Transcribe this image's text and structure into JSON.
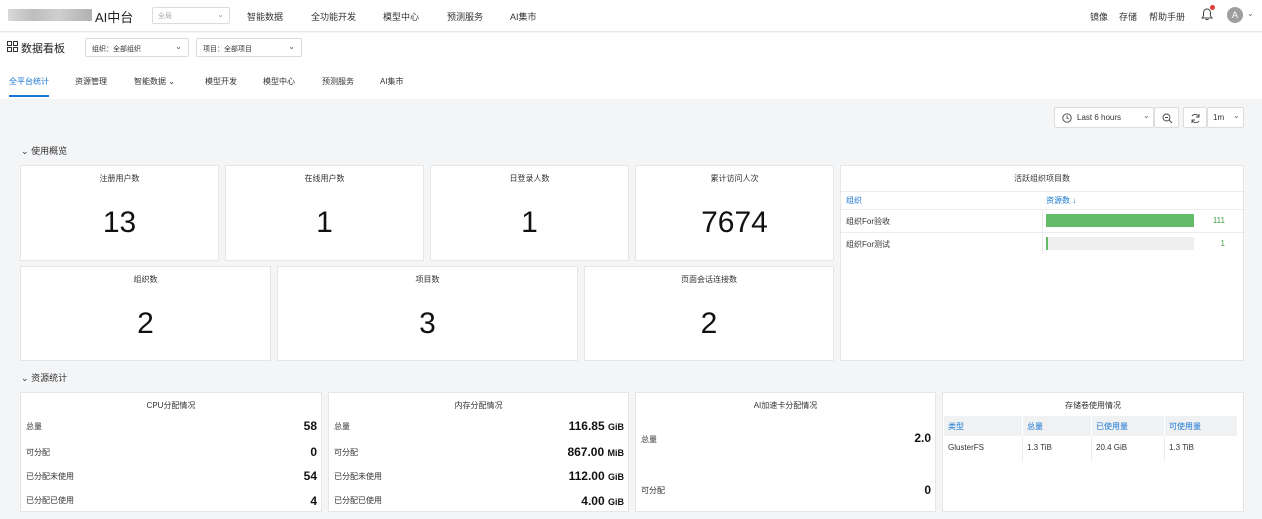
{
  "topnav": {
    "brand": "AI中台",
    "scope": "全局",
    "links": [
      "智能数据",
      "全功能开发",
      "模型中心",
      "预测服务",
      "AI集市"
    ],
    "right_links": [
      "镜像",
      "存储",
      "帮助手册"
    ],
    "avatar": "A"
  },
  "header": {
    "title": "数据看板",
    "org_filter": "组织：全部组织",
    "project_filter": "项目：全部项目"
  },
  "tabs": [
    "全平台统计",
    "资源管理",
    "智能数据",
    "模型开发",
    "模型中心",
    "预测服务",
    "AI集市"
  ],
  "time_controls": {
    "range": "Last 6 hours",
    "refresh": "1m"
  },
  "usage": {
    "section_title": "使用概览",
    "cards_row1": [
      {
        "label": "注册用户数",
        "value": "13"
      },
      {
        "label": "在线用户数",
        "value": "1"
      },
      {
        "label": "日登录人数",
        "value": "1"
      },
      {
        "label": "累计访问人次",
        "value": "7674"
      }
    ],
    "cards_row2": [
      {
        "label": "组织数",
        "value": "2"
      },
      {
        "label": "项目数",
        "value": "3"
      },
      {
        "label": "页面会话连接数",
        "value": "2"
      }
    ],
    "active_orgs": {
      "title": "活跃组织项目数",
      "col_org": "组织",
      "col_count": "资源数 ↓",
      "rows": [
        {
          "name": "组织For验收",
          "value": 111,
          "display": "111"
        },
        {
          "name": "组织For测试",
          "value": 1,
          "display": "1"
        }
      ],
      "max": 111
    }
  },
  "resources": {
    "section_title": "资源统计",
    "cpu": {
      "title": "CPU分配情况",
      "rows": [
        {
          "label": "总量",
          "value": "58",
          "unit": ""
        },
        {
          "label": "可分配",
          "value": "0",
          "unit": ""
        },
        {
          "label": "已分配未使用",
          "value": "54",
          "unit": ""
        },
        {
          "label": "已分配已使用",
          "value": "4",
          "unit": ""
        }
      ]
    },
    "memory": {
      "title": "内存分配情况",
      "rows": [
        {
          "label": "总量",
          "value": "116.85",
          "unit": "GiB"
        },
        {
          "label": "可分配",
          "value": "867.00",
          "unit": "MiB"
        },
        {
          "label": "已分配未使用",
          "value": "112.00",
          "unit": "GiB"
        },
        {
          "label": "已分配已使用",
          "value": "4.00",
          "unit": "GiB"
        }
      ]
    },
    "accel": {
      "title": "AI加速卡分配情况",
      "rows": [
        {
          "label": "总量",
          "value": "2.0"
        },
        {
          "label": "可分配",
          "value": "0"
        }
      ]
    },
    "storage": {
      "title": "存储卷使用情况",
      "headers": [
        "类型",
        "总量",
        "已使用量",
        "可使用量"
      ],
      "rows": [
        [
          "GlusterFS",
          "1.3 TiB",
          "20.4 GiB",
          "1.3 TiB"
        ]
      ]
    }
  }
}
